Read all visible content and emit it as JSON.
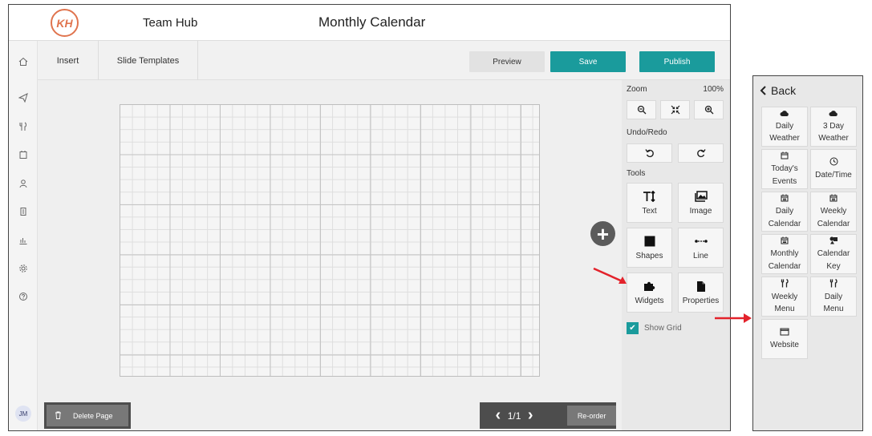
{
  "header": {
    "logo_text": "KH",
    "app_title": "Team Hub",
    "page_title": "Monthly Calendar"
  },
  "sidebar": {
    "icons": [
      "home-icon",
      "send-icon",
      "utensils-icon",
      "calendar-icon",
      "user-icon",
      "building-icon",
      "chart-icon",
      "gear-icon",
      "help-icon"
    ],
    "avatar": "JM"
  },
  "toolbar": {
    "insert_label": "Insert",
    "templates_label": "Slide Templates",
    "preview_label": "Preview",
    "save_label": "Save",
    "publish_label": "Publish"
  },
  "colors": {
    "accent": "#1a9b9c",
    "logo": "#e0744e",
    "annotation": "#e3222b"
  },
  "tools": {
    "zoom_label": "Zoom",
    "zoom_value": "100%",
    "undo_label": "Undo/Redo",
    "tools_label": "Tools",
    "text_label": "Text",
    "image_label": "Image",
    "shapes_label": "Shapes",
    "line_label": "Line",
    "widgets_label": "Widgets",
    "properties_label": "Properties",
    "show_grid_label": "Show Grid",
    "show_grid_checked": true
  },
  "bottom": {
    "delete_label": "Delete Page",
    "page_indicator": "1/1",
    "reorder_label": "Re-order"
  },
  "widgets_panel": {
    "back_label": "Back",
    "items": [
      {
        "line1": "Daily",
        "line2": "Weather",
        "icon": "cloud-icon"
      },
      {
        "line1": "3 Day",
        "line2": "Weather",
        "icon": "cloud-icon"
      },
      {
        "line1": "Today's",
        "line2": "Events",
        "icon": "calendar-icon"
      },
      {
        "line1": "Date/Time",
        "line2": "",
        "icon": "clock-icon"
      },
      {
        "line1": "Daily",
        "line2": "Calendar",
        "icon": "calendar-icon"
      },
      {
        "line1": "Weekly",
        "line2": "Calendar",
        "icon": "calendar-icon"
      },
      {
        "line1": "Monthly",
        "line2": "Calendar",
        "icon": "calendar-icon"
      },
      {
        "line1": "Calendar",
        "line2": "Key",
        "icon": "shapes-icon"
      },
      {
        "line1": "Weekly",
        "line2": "Menu",
        "icon": "utensils-icon"
      },
      {
        "line1": "Daily",
        "line2": "Menu",
        "icon": "utensils-icon"
      },
      {
        "line1": "Website",
        "line2": "",
        "icon": "window-icon"
      }
    ]
  }
}
